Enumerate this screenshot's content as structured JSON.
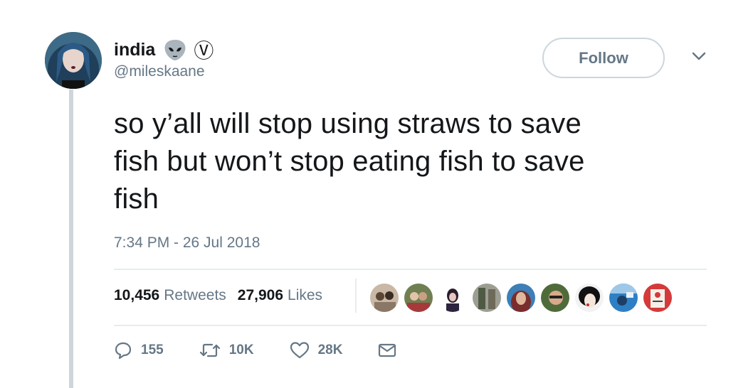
{
  "user": {
    "display_name": "india",
    "handle": "@mileskaane",
    "name_emoji": "alien-face-icon",
    "name_symbol": "Ⓥ"
  },
  "follow_label": "Follow",
  "tweet": {
    "line1": "so y’all will stop using straws to save",
    "line2": "fish but won’t stop eating fish to save",
    "line3": "fish",
    "timestamp": "7:34 PM - 26 Jul 2018"
  },
  "stats": {
    "retweets_count": "10,456",
    "retweets_label": "Retweets",
    "likes_count": "27,906",
    "likes_label": "Likes"
  },
  "actions": {
    "reply_count": "155",
    "retweet_count": "10K",
    "like_count": "28K"
  },
  "colors": {
    "text": "#14171a",
    "secondary": "#657786",
    "border": "#ccd6dd",
    "divider": "#e6ecf0"
  }
}
